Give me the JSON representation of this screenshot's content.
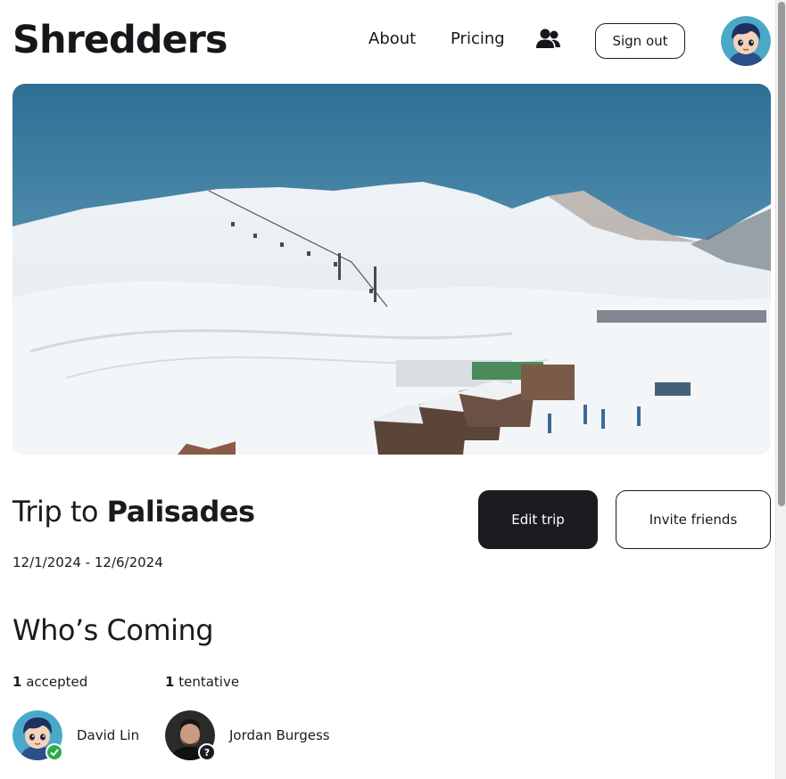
{
  "header": {
    "logo": "Shredders",
    "nav": {
      "about": "About",
      "pricing": "Pricing"
    },
    "friends_icon": "users-icon",
    "sign_out": "Sign out",
    "avatar_icon": "cartoon-avatar"
  },
  "hero": {
    "image": "snowy-ski-resort-mountains",
    "alt": "Snowy ski resort with chairlifts and lodges"
  },
  "trip": {
    "title_prefix": "Trip to",
    "destination": "Palisades",
    "dates": "12/1/2024 - 12/6/2024",
    "edit_label": "Edit trip",
    "invite_label": "Invite friends"
  },
  "whos_coming": {
    "title": "Who’s Coming",
    "accepted": {
      "count": "1",
      "label": "accepted"
    },
    "tentative": {
      "count": "1",
      "label": "tentative"
    },
    "people": [
      {
        "name": "David Lin",
        "status": "accepted",
        "status_icon": "check-icon"
      },
      {
        "name": "Jordan Burgess",
        "status": "tentative",
        "status_icon": "question-icon",
        "status_glyph": "?"
      }
    ]
  },
  "colors": {
    "primary_dark": "#1b1c20",
    "accepted_green": "#2fa84f",
    "sky": "#3e7fa3"
  }
}
